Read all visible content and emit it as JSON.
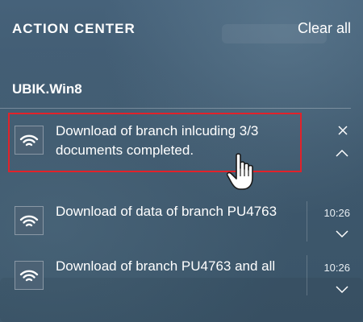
{
  "header": {
    "title": "ACTION CENTER",
    "clear_all": "Clear all"
  },
  "group": {
    "app_name": "UBIK.Win8"
  },
  "notifications": [
    {
      "text_line1": "Download of branch inlcuding 3/3",
      "text_line2": "documents completed.",
      "expanded": true,
      "highlighted": true,
      "icon": "wifi-signal-icon"
    },
    {
      "text": "Download of data of branch PU4763",
      "time": "10:26",
      "icon": "wifi-signal-icon"
    },
    {
      "text": "Download of branch PU4763 and all",
      "time": "10:26",
      "icon": "wifi-signal-icon"
    }
  ],
  "colors": {
    "highlight": "#e2222a",
    "panel": "#3f5a6e"
  }
}
